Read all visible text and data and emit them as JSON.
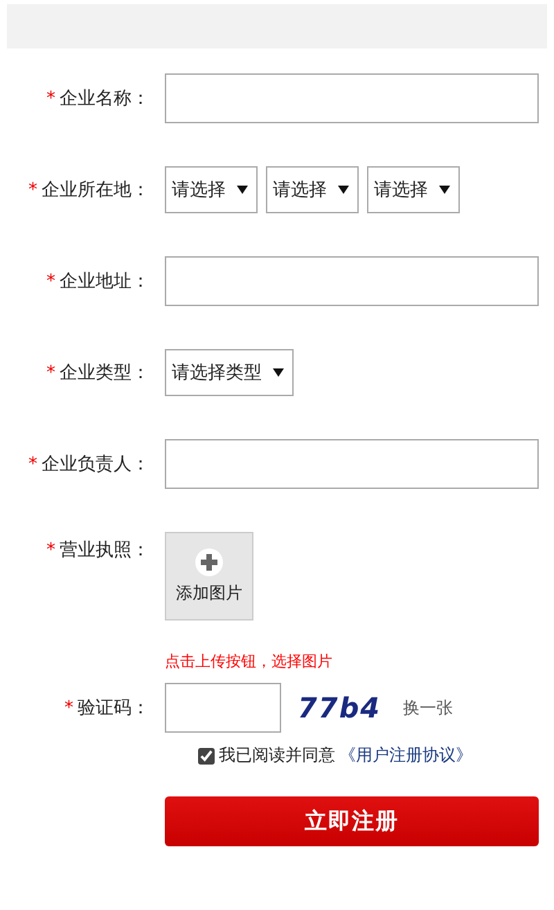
{
  "fields": [
    {
      "kind": "text",
      "marker": "*",
      "label": "企业名称："
    },
    {
      "kind": "selects",
      "marker": "*",
      "label": "企业所在地：",
      "options": [
        "请选择",
        "请选择",
        "请选择"
      ]
    },
    {
      "kind": "text",
      "marker": "*",
      "label": "企业地址："
    },
    {
      "kind": "selects",
      "marker": "*",
      "label": "企业类型：",
      "options": [
        "请选择类型"
      ]
    },
    {
      "kind": "text",
      "marker": "*",
      "label": "企业负责人："
    },
    {
      "kind": "upload",
      "marker": "*",
      "label": "营业执照：",
      "button": "添加图片",
      "hint": "点击上传按钮，选择图片"
    },
    {
      "kind": "captcha",
      "marker": "*",
      "label": "验证码：",
      "code": "77b4",
      "refresh": "换一张"
    }
  ],
  "agreement": {
    "checked": true,
    "text": "我已阅读并同意",
    "link": "《用户注册协议》"
  },
  "submit": "立即注册"
}
